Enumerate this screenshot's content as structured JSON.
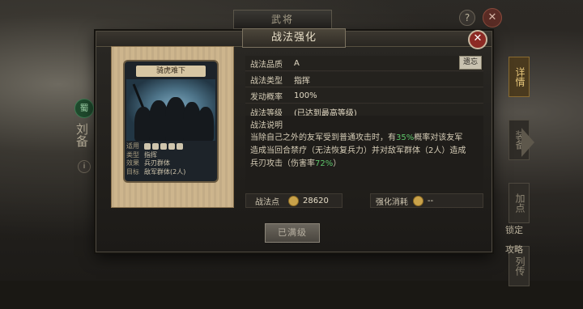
{
  "background": {
    "top_title": "武将",
    "help_label": "?",
    "close_label": "✕",
    "left_panel": {
      "faction_icon": "蜀",
      "general_name": "刘备",
      "info_dot": "i"
    },
    "right_tabs": [
      "详情",
      "装备",
      "加点",
      "列传"
    ],
    "lock_link": "锁定",
    "guide_link": "攻略"
  },
  "modal": {
    "title": "战法强化",
    "close_label": "✕",
    "card": {
      "name": "骑虎难下",
      "rows": [
        {
          "key": "适用",
          "value": ""
        },
        {
          "key": "类型",
          "value": "指挥"
        },
        {
          "key": "效果",
          "value": "兵刃群体"
        },
        {
          "key": "目标",
          "value": "敌军群体(2人)"
        }
      ]
    },
    "info": [
      {
        "key": "战法品质",
        "value": "A"
      },
      {
        "key": "战法类型",
        "value": "指挥"
      },
      {
        "key": "发动概率",
        "value": "100%"
      },
      {
        "key": "战法等级",
        "value": "(已达到最高等级)"
      }
    ],
    "swap_button": "遗忘",
    "desc": {
      "title": "战法说明",
      "line1_a": "当除自己之外的友军受到普通攻击时，有",
      "line1_hl": "35%",
      "line1_b": "概率对该友军",
      "line2": "造成当回合禁疗（无法恢复兵力）并对敌军群体（2人）造成",
      "line3_a": "兵刃攻击（伤害率",
      "line3_hl": "72%",
      "line3_b": "）"
    },
    "stats": {
      "points_label": "战法点",
      "points_value": "28620",
      "cost_label": "强化消耗",
      "cost_value": "--"
    },
    "max_button": "已满级"
  },
  "colors": {
    "accent_green": "#5ec56a",
    "close_red": "#8c2a24",
    "coin_gold": "#c9a24a"
  }
}
